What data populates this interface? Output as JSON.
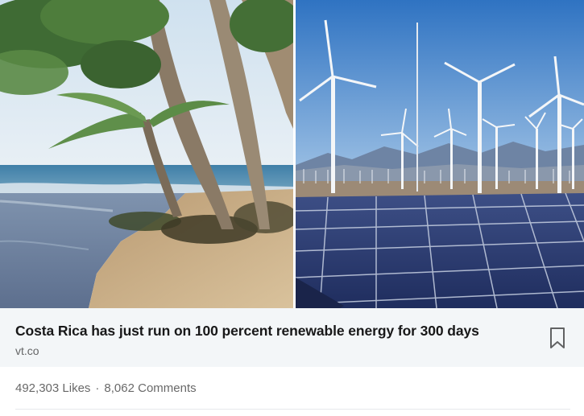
{
  "article": {
    "title": "Costa Rica has just run on 100 percent renewable energy for 300 days",
    "source": "vt.co",
    "bookmark_icon": "bookmark-icon"
  },
  "images": {
    "left": "beach with palm trees",
    "right": "wind turbines and solar panels"
  },
  "social": {
    "likes": "492,303 Likes",
    "separator": "·",
    "comments": "8,062 Comments"
  },
  "colors": {
    "link_bar_bg": "#f3f6f8",
    "title_text": "#191919",
    "meta_text": "#666666"
  }
}
